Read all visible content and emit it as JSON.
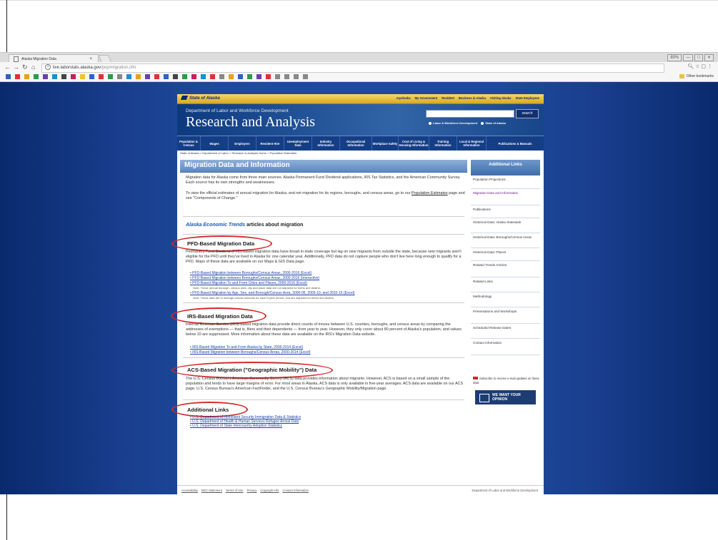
{
  "browser": {
    "tab_title": "Alaska Migration Data",
    "tab_close": "×",
    "window_buttons": [
      "80%",
      "—",
      "□",
      "✕"
    ],
    "url_host": "live.laborstats.alaska.gov",
    "url_path": "/pop/migration.cfm",
    "other_bookmarks": "Other bookmarks"
  },
  "site": {
    "state_logo": "State of Alaska",
    "top_links": [
      "myAlaska",
      "My Government",
      "Resident",
      "Business in Alaska",
      "Visiting Alaska",
      "State Employees"
    ],
    "dept": "Department of Labor and Workforce Development",
    "title": "Research and Analysis",
    "search_button": "search",
    "radio_labels": [
      "Labor & Workforce Development",
      "State of Alaska"
    ],
    "nav": [
      "Population & Census",
      "Wages",
      "Employers",
      "Resident Hire",
      "Unemployment Data",
      "Industry Information",
      "Occupational Information",
      "Workplace Safety",
      "Cost of Living & Housing Information",
      "Training Information",
      "Local & Regional Information",
      "Publications & Manuals"
    ],
    "breadcrumb": "State of Alaska > Department of Labor > Research & Analysis Home > Population Estimates"
  },
  "content": {
    "page_title": "Migration Data and Information",
    "intro1": "Migration data for Alaska come from three main sources: Alaska Permanent Fund Dividend applications, IRS Tax Statistics, and the American Community Survey. Each source has its own strengths and weaknesses.",
    "intro2_a": "To view the official estimates of annual migration for Alaska, and net migration for its regions, boroughs, and census areas, go to our ",
    "intro2_link": "Population Estimates",
    "intro2_b": " page and see \"Components of Change.\"",
    "trends_em": "Alaska Economic Trends",
    "trends_rest": " articles about migration",
    "pfd_heading": "PFD-Based Migration Data",
    "pfd_text": "Permanent Fund Dividend (PFD)-based migration data have broad in-state coverage but lag on new migrants from outside the state, because new migrants aren't eligible for the PFD until they've lived in Alaska for one calendar year. Additionally, PFD data do not capture people who don't live here long enough to qualify for a PFD. Maps of these data are available on our Maps & GIS Data page.",
    "pfd_links": [
      "PFD-Based Migration between Boroughs/Census Areas, 2000-2016 (Excel)",
      "PFD-Based Migration between Boroughs/Census Areas, 2000-2016 (Interactive)",
      "PFD-Based Migration To and From Cities and Places, 2000-2016 (Excel)"
    ],
    "pfd_note1": "Note: These annual borough, census area, city and place data are not adjusted for births and deaths.",
    "pfd_link4": "PFD-Based Migration by Age, Sex, and Borough/Census Area, 2000-05, 2005-10, and 2010-15 (Excel)",
    "pfd_note2": "Note: These data are in average annual amounts for each 5-year period, and are adjusted for births and deaths.",
    "irs_heading": "IRS-Based Migration Data",
    "irs_text": "Internal Revenue Service (IRS)-based migration data provide direct counts of moves between U.S. counties, boroughs, and census areas by comparing the addresses of exemptions — that is, filers and their dependents — from year to year. However, they only cover about 80 percent of Alaska's population, and values below 10 are suppressed. More information about these data are available on the IRS's Migration Data website.",
    "irs_links": [
      "IRS-Based Migration To and From Alaska by State, 2000-2014 (Excel)",
      "IRS-Based Migration between Boroughs/Census Areas, 2000-2014 (Excel)"
    ],
    "acs_heading": "ACS-Based Migration (\"Geographic Mobility\") Data",
    "acs_text": "The U.S. Census Bureau's American Community Survey (ACS) data provides information about migrants. However, ACS is based on a small sample of the population and tends to have large margins of error. For most areas in Alaska, ACS data is only available in five-year averages. ACS data are available on our ACS page, U.S. Census Bureau's American FactFinder, and the U.S. Census Bureau's Geographic Mobility/Migration page.",
    "add_heading": "Additional Links",
    "add_links": [
      "U.S. Department of Homeland Security Immigration Data & Statistics",
      "U.S. Department of Health & Human Services Refugee Arrival Data",
      "U.S. Department of State Intercountry Adoption Statistics"
    ]
  },
  "sidebar": {
    "head": "Additional Links",
    "items": [
      "Population Projections",
      "Migration Data and Information",
      "Publications",
      "Historical Data: Alaska Statewide",
      "Historical Data: Boroughs/Census Areas",
      "Historical Data: Places",
      "Related Trends Articles",
      "Related Links",
      "Methodology",
      "Presentations and Workshops",
      "Scheduled Release Dates",
      "Contact Information"
    ],
    "subscribe": "Subscribe to receive e-mail updates on these data",
    "opinion": "WE WANT YOUR OPINION"
  },
  "footer": {
    "links": [
      "Accessibility",
      "EEO Statement",
      "Terms of Use",
      "Privacy",
      "Copyright Info",
      "Contact Information"
    ],
    "right": "Department of Labor and Workforce Development"
  }
}
